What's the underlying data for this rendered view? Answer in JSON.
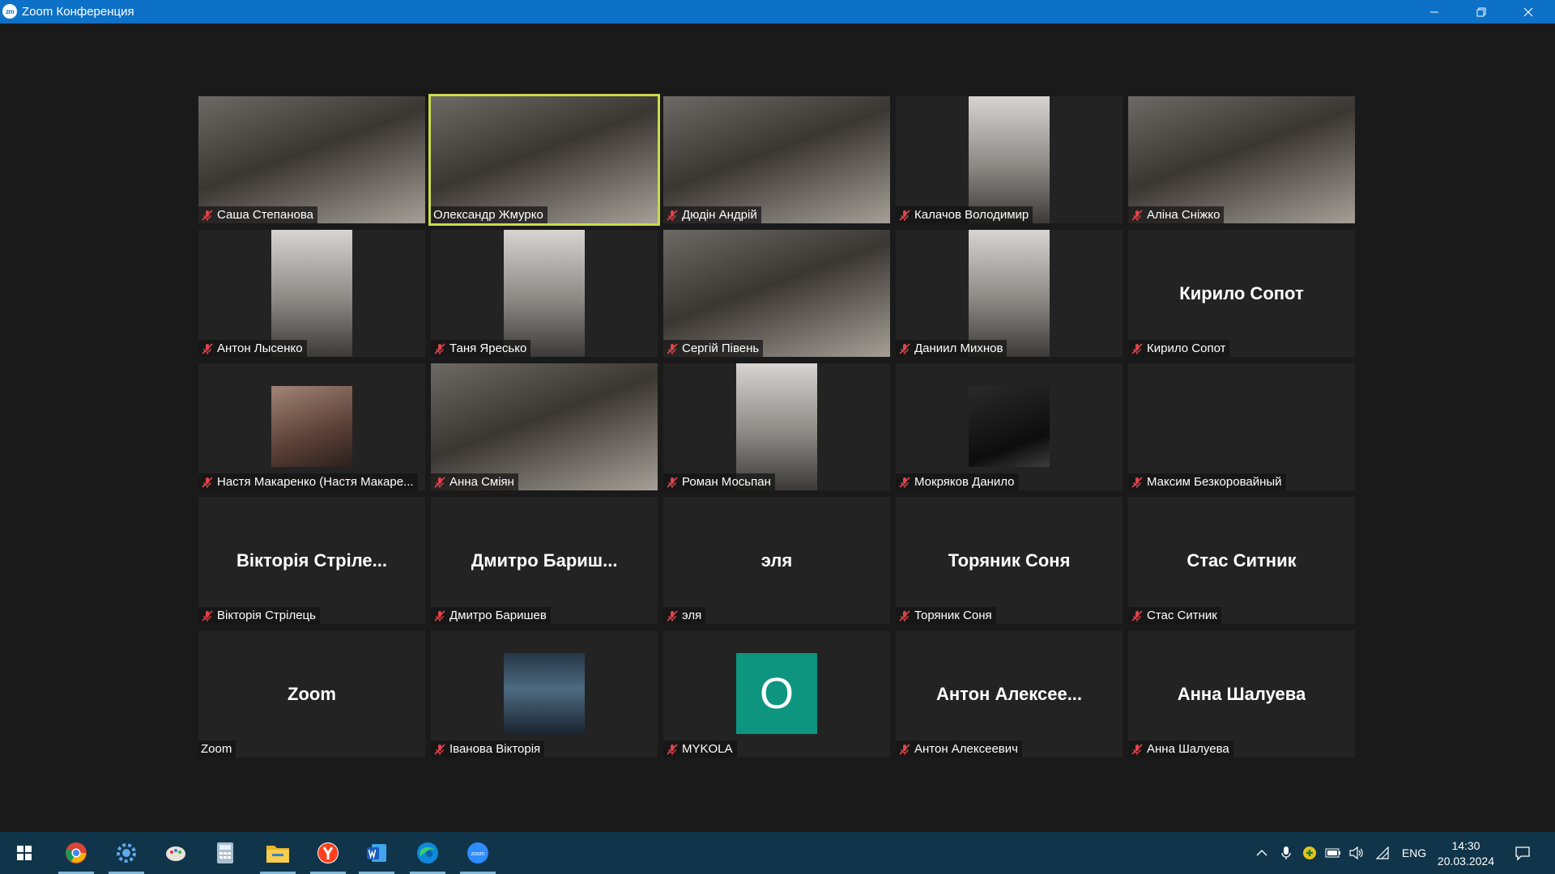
{
  "window": {
    "app_icon": "zm",
    "title": "Zoom Конференция",
    "buttons": [
      "minimize-icon",
      "restore-icon",
      "close-icon"
    ]
  },
  "participants": [
    {
      "name": "Саша Степанова",
      "muted": true,
      "mode": "video",
      "active": false
    },
    {
      "name": "Олександр Жмурко",
      "muted": false,
      "mode": "video",
      "active": true
    },
    {
      "name": "Дюдін Андрій",
      "muted": true,
      "mode": "video",
      "active": false
    },
    {
      "name": "Калачов Володимир",
      "muted": true,
      "mode": "video-narrow",
      "active": false
    },
    {
      "name": "Аліна Сніжко",
      "muted": true,
      "mode": "video",
      "active": false
    },
    {
      "name": "Антон Лысенко",
      "muted": true,
      "mode": "video-narrow",
      "active": false
    },
    {
      "name": "Таня Яресько",
      "muted": true,
      "mode": "video-narrow",
      "active": false
    },
    {
      "name": "Сергій Півень",
      "muted": true,
      "mode": "video",
      "active": false
    },
    {
      "name": "Даниил Михнов",
      "muted": true,
      "mode": "video-narrow",
      "active": false
    },
    {
      "name": "Кирило Сопот",
      "display": "Кирило Сопот",
      "muted": true,
      "mode": "name",
      "active": false
    },
    {
      "name": "Настя Макаренко (Настя Макаре...",
      "muted": true,
      "mode": "photo",
      "active": false
    },
    {
      "name": "Анна Сміян",
      "muted": true,
      "mode": "video",
      "active": false
    },
    {
      "name": "Роман Мосьпан",
      "muted": true,
      "mode": "video-narrow",
      "active": false
    },
    {
      "name": "Мокряков Данило",
      "muted": true,
      "mode": "photo-dark",
      "active": false
    },
    {
      "name": "Максим Безкоровайный",
      "muted": true,
      "mode": "blank",
      "active": false
    },
    {
      "name": "Вікторія Стрілець",
      "display": "Вікторія Стріле...",
      "muted": true,
      "mode": "name",
      "active": false
    },
    {
      "name": "Дмитро Баришев",
      "display": "Дмитро  Бариш...",
      "muted": true,
      "mode": "name",
      "active": false
    },
    {
      "name": "эля",
      "display": "эля",
      "muted": true,
      "mode": "name",
      "active": false
    },
    {
      "name": "Торяник Соня",
      "display": "Торяник Соня",
      "muted": true,
      "mode": "name",
      "active": false
    },
    {
      "name": "Стас Ситник",
      "display": "Стас Ситник",
      "muted": true,
      "mode": "name",
      "active": false
    },
    {
      "name": "Zoom",
      "display": "Zoom",
      "muted": false,
      "mode": "name",
      "active": false
    },
    {
      "name": "Іванова Вікторія",
      "muted": true,
      "mode": "photo-landscape",
      "active": false
    },
    {
      "name": "MYKOLA",
      "avatar_letter": "O",
      "avatar_color": "#0e9580",
      "muted": true,
      "mode": "avatar",
      "active": false
    },
    {
      "name": "Антон Алексеевич",
      "display": "Антон  Алексее...",
      "muted": true,
      "mode": "name",
      "active": false
    },
    {
      "name": "Анна Шалуева",
      "display": "Анна Шалуева",
      "muted": true,
      "mode": "name",
      "active": false
    }
  ],
  "colors": {
    "titlebar": "#0e71c8",
    "background": "#1a1a1a",
    "tile": "#232323",
    "active_border": "#c9dc4a",
    "mute": "#e0434b",
    "taskbar": "#10354a"
  },
  "taskbar": {
    "apps": [
      {
        "name": "start-icon",
        "running": false
      },
      {
        "name": "chrome-icon",
        "running": true
      },
      {
        "name": "settings-icon",
        "running": true
      },
      {
        "name": "paint-icon",
        "running": false
      },
      {
        "name": "calculator-icon",
        "running": false
      },
      {
        "name": "file-explorer-icon",
        "running": true
      },
      {
        "name": "yandex-browser-icon",
        "running": true
      },
      {
        "name": "word-icon",
        "running": true
      },
      {
        "name": "edge-icon",
        "running": true
      },
      {
        "name": "zoom-icon",
        "running": true
      }
    ],
    "tray_icons": [
      "chevron-up-icon",
      "microphone-icon",
      "vpn-icon",
      "battery-icon",
      "volume-icon",
      "wifi-icon"
    ],
    "language": "ENG",
    "time": "14:30",
    "date": "20.03.2024"
  }
}
